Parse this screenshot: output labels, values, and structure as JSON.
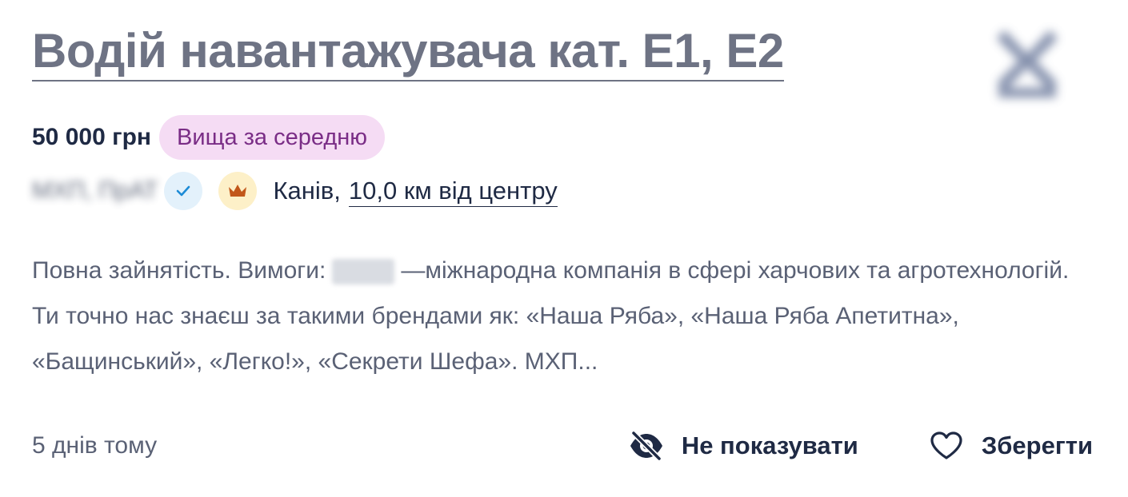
{
  "vacancy": {
    "title": "Водій навантажувача кат. E1, E2",
    "salary": "50 000 грн",
    "salary_badge": "Вища за середню",
    "company_name": "МХП, ПрАТ",
    "city": "Канів,",
    "distance": "10,0 км від центру",
    "description_part1": "Повна зайнятість. Вимоги:",
    "description_part2": "—міжнародна компанія в сфері харчових та агротехнологій. Ти точно нас знаєш за такими брендами як: «Наша Ряба», «Наша Ряба Апетитна», «Бащинський», «Легко!», «Секрети Шефа». МХП...",
    "posted": "5 днів тому"
  },
  "actions": {
    "hide_label": "Не показувати",
    "save_label": "Зберегти"
  },
  "icons": {
    "verified": "checkmark-icon",
    "premium": "crown-icon",
    "hide": "eye-off-icon",
    "save": "heart-icon"
  },
  "colors": {
    "title": "#6e7384",
    "badge_bg": "#f5dcf4",
    "badge_text": "#7a2d86",
    "verified_bg": "#e3f1fb",
    "verified_check": "#1c8bd6",
    "crown_bg": "#fdf0c8",
    "crown": "#c2571a"
  }
}
